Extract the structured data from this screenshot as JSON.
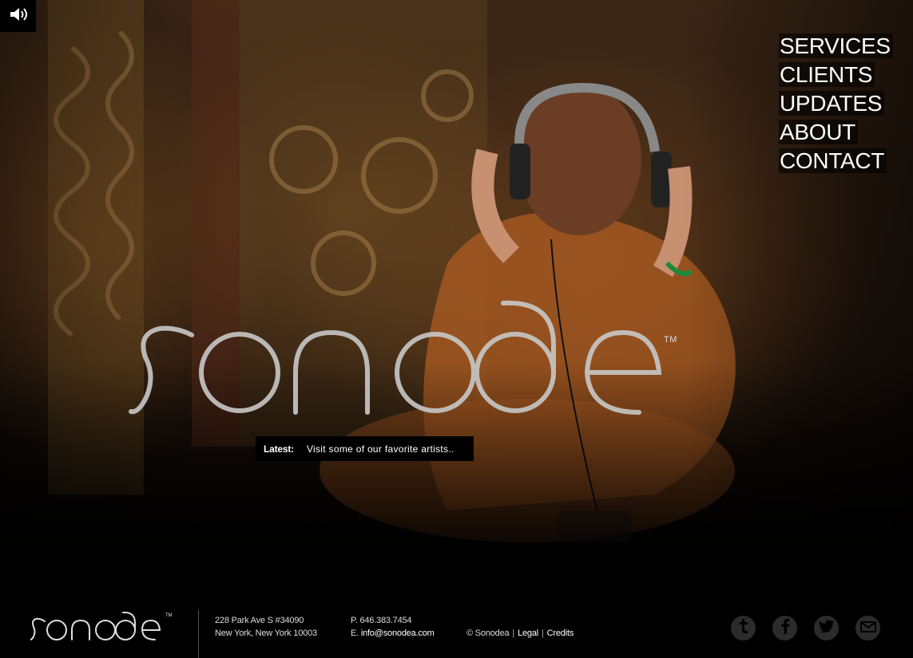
{
  "nav": {
    "items": [
      {
        "label": "SERVICES"
      },
      {
        "label": "CLIENTS"
      },
      {
        "label": "UPDATES"
      },
      {
        "label": "ABOUT"
      },
      {
        "label": "CONTACT"
      }
    ]
  },
  "brand": {
    "logo_text": "sonodea",
    "trademark": "TM"
  },
  "latest": {
    "label": "Latest:",
    "text": "Visit some of our favorite artists.."
  },
  "footer": {
    "address_line1": "228 Park Ave S #34090",
    "address_line2": "New York, New York 10003",
    "phone_label": "P.",
    "phone": "646.383.7454",
    "email_label": "E.",
    "email": "info@sonodea.com",
    "copyright": "© Sonodea",
    "legal": "Legal",
    "credits": "Credits"
  },
  "icons": {
    "sound": "speaker-icon",
    "socials": [
      "tumblr-icon",
      "facebook-icon",
      "twitter-icon",
      "mail-icon"
    ]
  },
  "colors": {
    "background": "#000000",
    "text": "#ffffff",
    "logo": "#c8c8c8",
    "social_circle": "#2b2b2b"
  }
}
